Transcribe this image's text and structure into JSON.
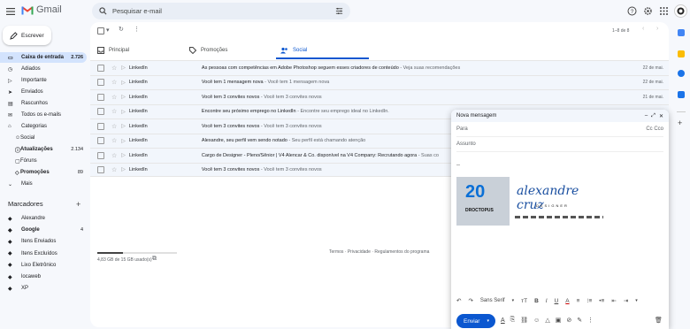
{
  "header": {
    "app_name": "Gmail",
    "search_placeholder": "Pesquisar e-mail"
  },
  "sidebar": {
    "compose_label": "Escrever",
    "items": [
      {
        "label": "Caixa de entrada",
        "count": "2.726",
        "icon": "inbox-icon",
        "selected": true
      },
      {
        "label": "Adiados",
        "count": "",
        "icon": "clock-icon"
      },
      {
        "label": "Importante",
        "count": "",
        "icon": "important-icon"
      },
      {
        "label": "Enviados",
        "count": "",
        "icon": "send-icon"
      },
      {
        "label": "Rascunhos",
        "count": "",
        "icon": "draft-icon"
      },
      {
        "label": "Todos os e-mails",
        "count": "",
        "icon": "mail-icon"
      },
      {
        "label": "Categorias",
        "count": "",
        "icon": "label-icon"
      }
    ],
    "categories": [
      {
        "label": "Social",
        "count": "",
        "icon": "people-icon"
      },
      {
        "label": "Atualizações",
        "count": "2.134",
        "icon": "info-icon",
        "bold": true
      },
      {
        "label": "Fóruns",
        "count": "",
        "icon": "forum-icon"
      },
      {
        "label": "Promoções",
        "count": "89",
        "icon": "tag-icon",
        "bold": true
      }
    ],
    "more_label": "Mais",
    "labels_title": "Marcadores",
    "labels": [
      {
        "label": "Alexandre",
        "count": ""
      },
      {
        "label": "Google",
        "count": "4",
        "bold": true
      },
      {
        "label": "Itens Enviados",
        "count": ""
      },
      {
        "label": "Itens Excluídos",
        "count": ""
      },
      {
        "label": "Lixo Eletrônico",
        "count": ""
      },
      {
        "label": "locaweb",
        "count": ""
      },
      {
        "label": "XP",
        "count": ""
      }
    ]
  },
  "toolbar": {
    "range": "1–8 de 8"
  },
  "tabs": [
    {
      "label": "Principal",
      "icon": "inbox-icon"
    },
    {
      "label": "Promoções",
      "icon": "tag-icon"
    },
    {
      "label": "Social",
      "icon": "people-icon",
      "active": true
    }
  ],
  "emails": [
    {
      "sender": "LinkedIn",
      "subject": "As pessoas com competências em Adobe Photoshop seguem esses criadores de conteúdo",
      "snippet": " - Veja suas recomendações",
      "date": "22 de mai."
    },
    {
      "sender": "LinkedIn",
      "subject": "Você tem 1 mensagem nova",
      "snippet": " - Você tem 1 mensagem nova",
      "date": "22 de mai."
    },
    {
      "sender": "LinkedIn",
      "subject": "Você tem 3 convites novos",
      "snippet": " - Você tem 3 convites novos",
      "date": "21 de mai."
    },
    {
      "sender": "LinkedIn",
      "subject": "Encontre seu próximo emprego no LinkedIn",
      "snippet": " - Encontre seu emprego ideal no LinkedIn.",
      "date": ""
    },
    {
      "sender": "LinkedIn",
      "subject": "Você tem 3 convites novos",
      "snippet": " - Você tem 3 convites novos",
      "date": ""
    },
    {
      "sender": "LinkedIn",
      "subject": "Alexandre, seu perfil vem sendo notado",
      "snippet": " - Seu perfil está chamando atenção",
      "date": ""
    },
    {
      "sender": "LinkedIn",
      "subject": "Cargo de Designer - Pleno/Sênior | V4 Alencar & Co. disponível na V4 Company: Recrutando agora",
      "snippet": " - Suas co",
      "date": ""
    },
    {
      "sender": "LinkedIn",
      "subject": "Você tem 3 convites novos",
      "snippet": " - Você tem 3 convites novos",
      "date": ""
    }
  ],
  "footer": {
    "storage": "4,83 GB de 15 GB usado(s)",
    "storage_fraction": 0.32,
    "links": "Termos · Privacidade · Regulamentos do programa"
  },
  "compose_window": {
    "title": "Nova mensagem",
    "to_label": "Para",
    "cc_label": "Cc Cco",
    "subject_label": "Assunto",
    "separator": "--",
    "signature_badge": "20",
    "signature_brand": "DROCTOPUS",
    "signature_name": "alexandre cruz",
    "signature_role": "DESIGNER",
    "font_name": "Sans Serif",
    "send_label": "Enviar"
  },
  "colors": {
    "accent": "#0b57d0",
    "selected_nav": "#d3e3fd",
    "background": "#f6f8fc"
  }
}
